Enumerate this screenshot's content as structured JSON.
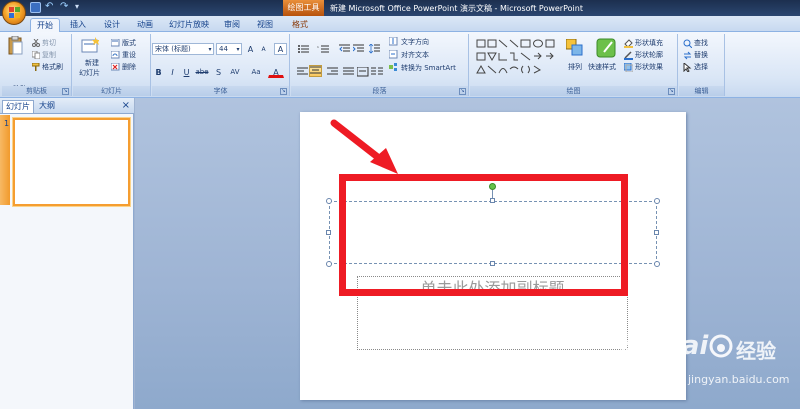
{
  "title_bar": {
    "context_tool": "绘图工具",
    "document_title": "新建 Microsoft Office PowerPoint 演示文稿 - Microsoft PowerPoint"
  },
  "tabs": [
    {
      "label": "开始",
      "active": true
    },
    {
      "label": "插入"
    },
    {
      "label": "设计"
    },
    {
      "label": "动画"
    },
    {
      "label": "幻灯片放映"
    },
    {
      "label": "审阅"
    },
    {
      "label": "视图"
    },
    {
      "label": "格式",
      "contextual": true
    }
  ],
  "ribbon": {
    "clipboard": {
      "paste": "粘贴",
      "cut": "剪切",
      "copy": "复制",
      "format_painter": "格式刷",
      "label": "剪贴板"
    },
    "slides": {
      "new_slide_line1": "新建",
      "new_slide_line2": "幻灯片",
      "layout": "版式",
      "reset": "重设",
      "delete": "删除",
      "label": "幻灯片"
    },
    "font": {
      "font_name": "宋体 (标题)",
      "font_size": "44",
      "grow": "A",
      "shrink": "A",
      "clear": "A",
      "bold": "B",
      "italic": "I",
      "underline": "U",
      "strike": "abe",
      "shadow": "S",
      "spacing": "AV",
      "case": "Aa",
      "color": "A",
      "label": "字体"
    },
    "paragraph": {
      "text_direction": "文字方向",
      "align_text": "对齐文本",
      "convert_smartart": "转换为 SmartArt",
      "label": "段落"
    },
    "drawing": {
      "arrange": "排列",
      "quick_styles": "快速样式",
      "shape_fill": "形状填充",
      "shape_outline": "形状轮廓",
      "shape_effects": "形状效果",
      "label": "绘图"
    },
    "editing": {
      "find": "查找",
      "replace": "替换",
      "select": "选择",
      "label": "编辑"
    }
  },
  "left_pane": {
    "tab_slides": "幻灯片",
    "tab_outline": "大纲",
    "close": "×",
    "slide_number": "1"
  },
  "slide": {
    "subtitle_placeholder": "单击此处添加副标题"
  },
  "watermark": {
    "brand": "Bai",
    "brand_suffix": "经验",
    "url": "jingyan.baidu.com"
  },
  "colors": {
    "annotation_red": "#ee1b24",
    "selected_thumb": "#f59d30"
  }
}
